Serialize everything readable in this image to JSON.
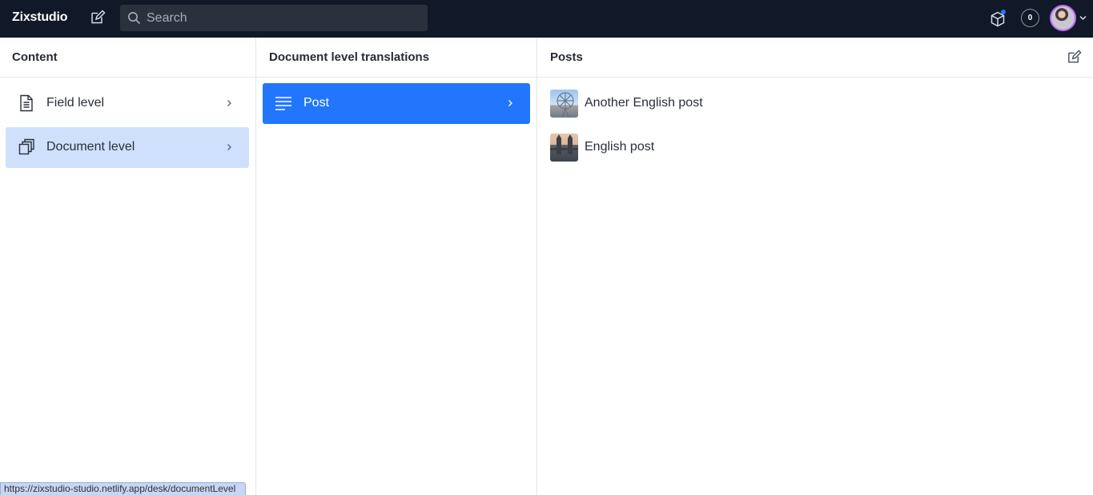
{
  "navbar": {
    "brand": "Zixstudio",
    "search_placeholder": "Search",
    "notification_count": "0"
  },
  "pane_content": {
    "title": "Content",
    "items": [
      {
        "label": "Field level",
        "icon": "document-icon",
        "selected": false
      },
      {
        "label": "Document level",
        "icon": "copy-icon",
        "selected": true
      }
    ]
  },
  "pane_translations": {
    "title": "Document level translations",
    "items": [
      {
        "label": "Post",
        "icon": "text-lines-icon",
        "selected": true
      }
    ]
  },
  "pane_posts": {
    "title": "Posts",
    "items": [
      {
        "label": "Another English post",
        "thumbnail": "ferris-wheel-thumbnail"
      },
      {
        "label": "English post",
        "thumbnail": "tower-bridge-thumbnail"
      }
    ]
  },
  "status_bar": {
    "url": "https://zixstudio-studio.netlify.app/desk/documentLevel"
  },
  "colors": {
    "navbar_bg": "#111827",
    "accent": "#2276fc",
    "selected_bg": "#cfe0fc",
    "avatar_ring": "#b66cf0"
  }
}
